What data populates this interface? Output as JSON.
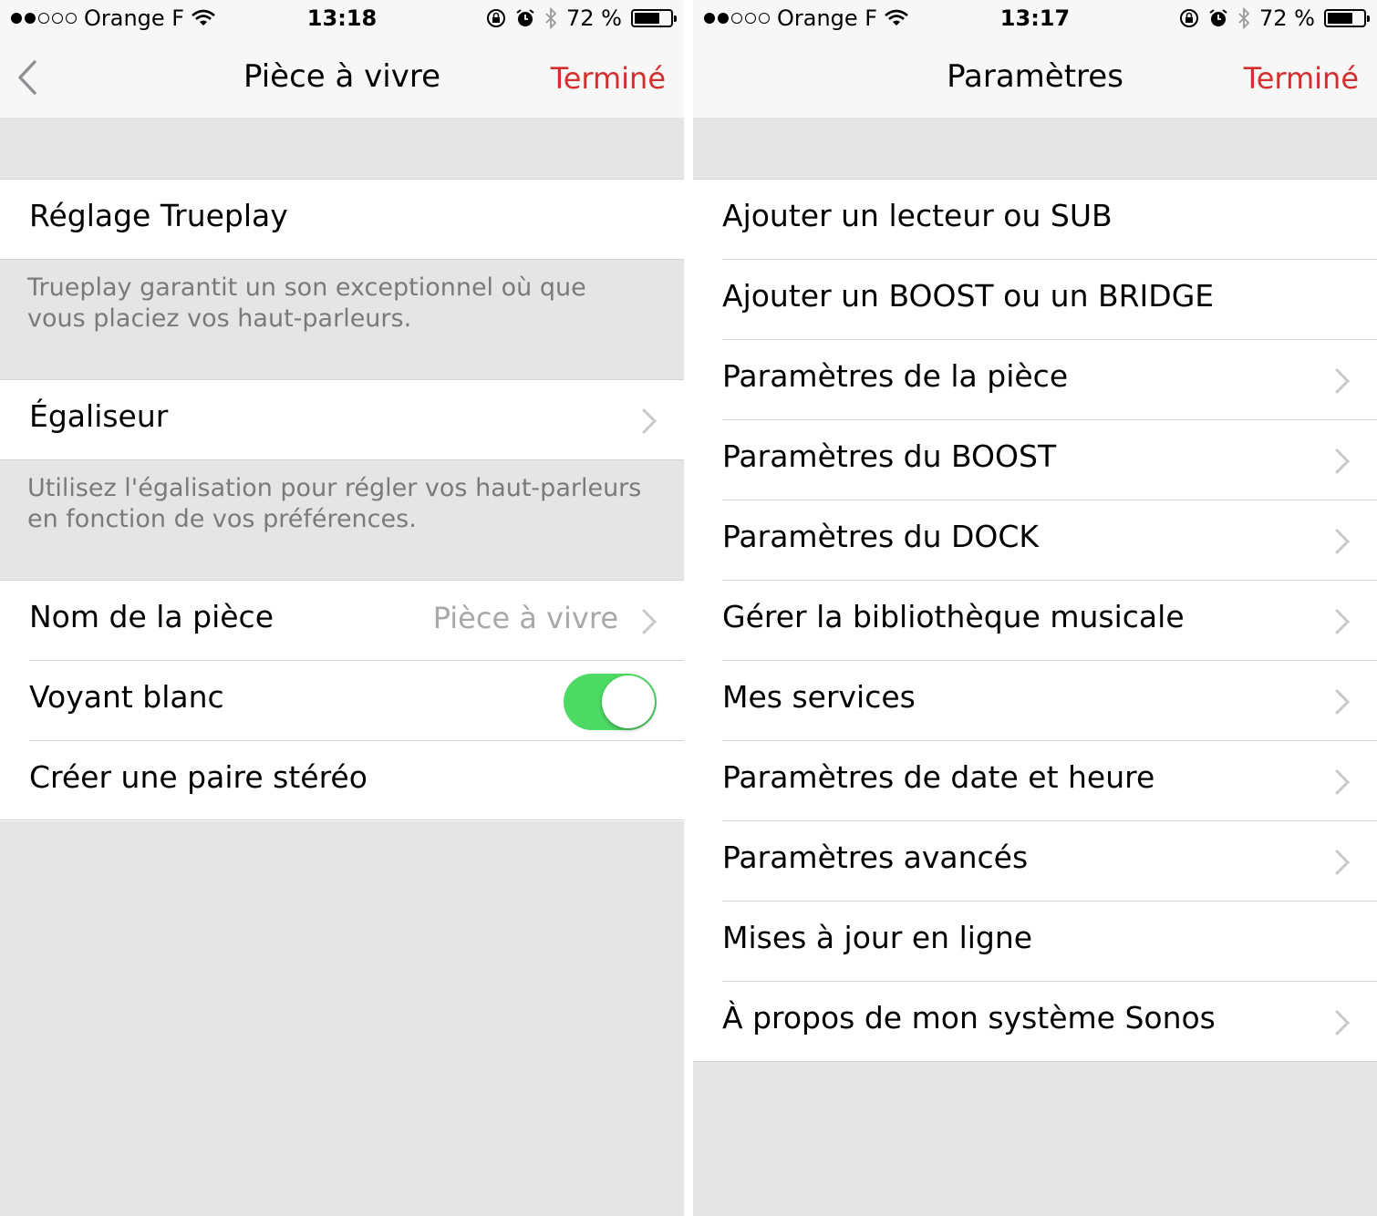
{
  "left": {
    "status": {
      "carrier": "Orange F",
      "time": "13:18",
      "battery": "72 %",
      "battery_level": 0.72
    },
    "nav": {
      "title": "Pièce à vivre",
      "done": "Terminé",
      "back_icon": "chevron-left-icon"
    },
    "trueplay": {
      "label": "Réglage Trueplay",
      "description": "Trueplay garantit un son exceptionnel où que vous placiez vos haut-parleurs."
    },
    "equalizer": {
      "label": "Égaliseur",
      "description": "Utilisez l'égalisation pour régler vos haut-parleurs en fonction de vos préférences."
    },
    "room_name": {
      "label": "Nom de la pièce",
      "value": "Pièce à vivre"
    },
    "white_light": {
      "label": "Voyant blanc",
      "on": true
    },
    "stereo_pair": {
      "label": "Créer une paire stéréo"
    },
    "colors": {
      "accent": "#d32f2f",
      "toggle_on": "#4cd964"
    }
  },
  "right": {
    "status": {
      "carrier": "Orange F",
      "time": "13:17",
      "battery": "72 %",
      "battery_level": 0.72
    },
    "nav": {
      "title": "Paramètres",
      "done": "Terminé"
    },
    "items": [
      {
        "label": "Ajouter un lecteur ou SUB",
        "chevron": false
      },
      {
        "label": "Ajouter un BOOST ou un BRIDGE",
        "chevron": false
      },
      {
        "label": "Paramètres de la pièce",
        "chevron": true
      },
      {
        "label": "Paramètres du BOOST",
        "chevron": true
      },
      {
        "label": "Paramètres du DOCK",
        "chevron": true
      },
      {
        "label": "Gérer la bibliothèque musicale",
        "chevron": true
      },
      {
        "label": "Mes services",
        "chevron": true
      },
      {
        "label": "Paramètres de date et heure",
        "chevron": true
      },
      {
        "label": "Paramètres avancés",
        "chevron": true
      },
      {
        "label": "Mises à jour en ligne",
        "chevron": false
      },
      {
        "label": "À propos de mon système Sonos",
        "chevron": true
      }
    ]
  }
}
